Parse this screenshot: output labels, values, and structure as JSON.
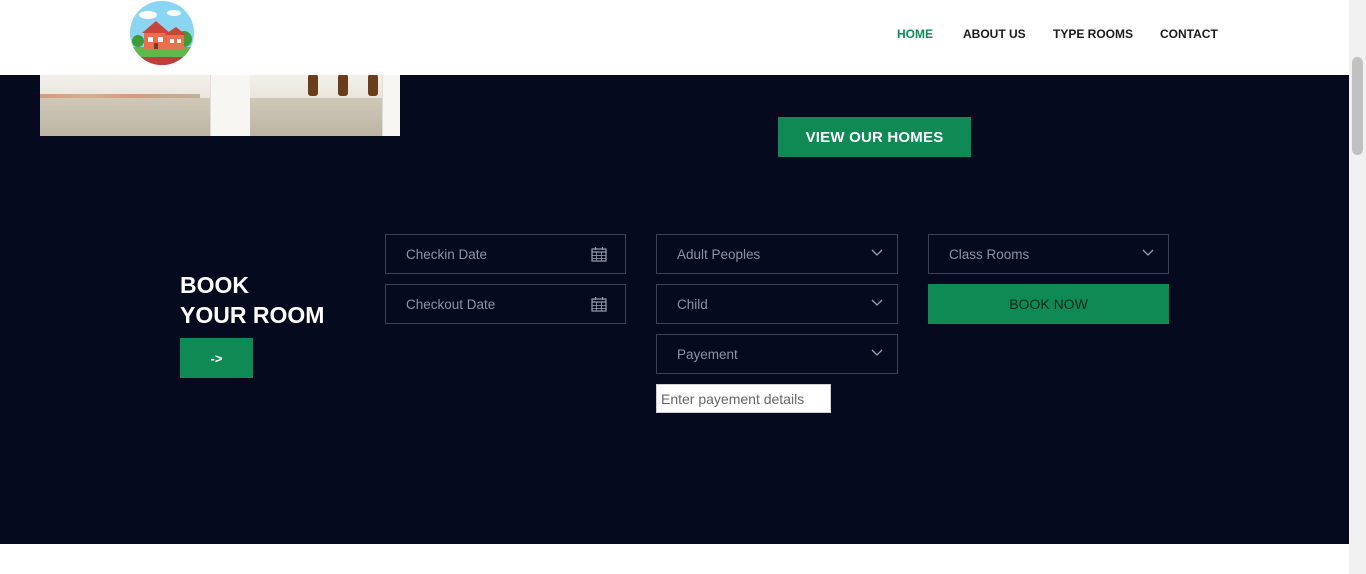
{
  "nav": {
    "items": [
      {
        "label": "HOME",
        "active": true
      },
      {
        "label": "ABOUT US",
        "active": false
      },
      {
        "label": "TYPE ROOMS",
        "active": false
      },
      {
        "label": "CONTACT",
        "active": false
      }
    ]
  },
  "hero": {
    "cta_label": "VIEW OUR HOMES"
  },
  "booking": {
    "title_line1": "BOOK",
    "title_line2": "YOUR ROOM",
    "arrow_label": "->",
    "checkin_placeholder": "Checkin Date",
    "checkout_placeholder": "Checkout Date",
    "adult_label": "Adult Peoples",
    "child_label": "Child",
    "payment_label": "Payement",
    "class_label": "Class Rooms",
    "book_now_label": "BOOK NOW",
    "payment_details_placeholder": "Enter payement details"
  },
  "icons": {
    "calendar": "calendar-icon",
    "chevron": "chevron-down-icon",
    "logo": "house-logo"
  },
  "colors": {
    "accent": "#0f8a55",
    "hero_bg": "#050a1f",
    "field_border": "#3b4153"
  }
}
